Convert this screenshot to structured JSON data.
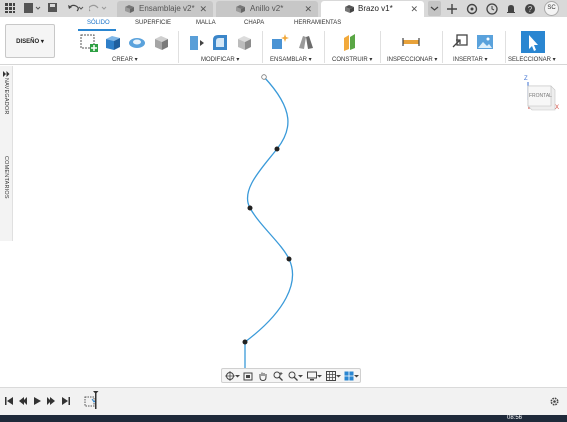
{
  "tabs": [
    {
      "label": "Ensamblaje v2*",
      "active": false
    },
    {
      "label": "Anillo v2*",
      "active": false
    },
    {
      "label": "Brazo v1*",
      "active": true
    }
  ],
  "user_initials": "SC",
  "ribbon": {
    "design_label": "DISEÑO ▾",
    "tabs": [
      "SÓLIDO",
      "SUPERFICIE",
      "MALLA",
      "CHAPA",
      "HERRAMIENTAS"
    ],
    "groups": [
      "CREAR ▾",
      "MODIFICAR ▾",
      "ENSAMBLAR ▾",
      "CONSTRUIR ▾",
      "INSPECCIONAR ▾",
      "INSERTAR ▾",
      "SELECCIONAR ▾"
    ]
  },
  "left_panel": {
    "navigator": "NAVEGADOR",
    "comments": "COMENTARIOS"
  },
  "viewcube": {
    "face": "FRONTAL",
    "axis_z": "Z",
    "axis_x": "X"
  },
  "clock": "08:56",
  "colors": {
    "accent": "#2a86d1",
    "curve": "#3a9ad9",
    "taskbar": "#1f2a3a"
  }
}
